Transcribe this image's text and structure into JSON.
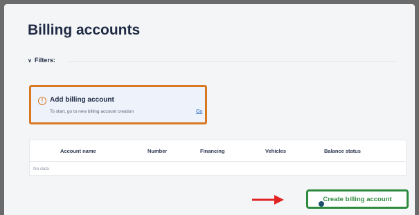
{
  "page": {
    "title": "Billing accounts"
  },
  "filters": {
    "label": "Filters:",
    "icon": "chevron-down-icon"
  },
  "notice": {
    "icon": "info-icon",
    "title": "Add billing account",
    "text": "To start, go to new billing account creation",
    "link": "Go"
  },
  "table": {
    "columns": [
      "Account name",
      "Number",
      "Financing",
      "Vehicles",
      "Balance status"
    ],
    "empty_text": "No data"
  },
  "actions": {
    "create_label": "Create billing account"
  },
  "colors": {
    "highlight_orange": "#d97822",
    "button_green": "#2e8b3e",
    "arrow_red": "#e02424",
    "link_blue": "#3772c6"
  }
}
